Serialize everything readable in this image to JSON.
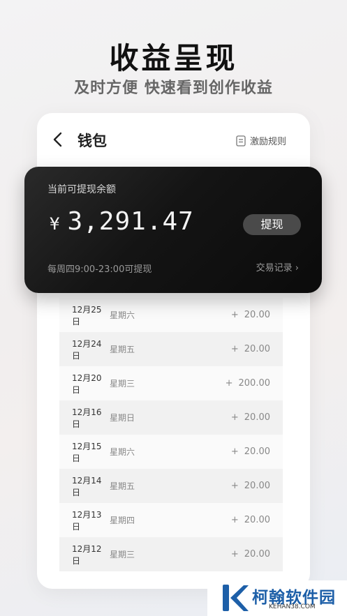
{
  "headline": {
    "title": "收益呈现",
    "subtitle": "及时方便 快速看到创作收益"
  },
  "topbar": {
    "title": "钱包",
    "rules_label": "激励规则"
  },
  "card": {
    "balance_label": "当前可提现余额",
    "currency": "¥",
    "balance": "3,291.47",
    "withdraw_label": "提现",
    "hours": "每周四9:00-23:00可提现",
    "records_label": "交易记录 ›"
  },
  "transactions": [
    {
      "date": "12月25日",
      "weekday": "星期六",
      "sign": "+",
      "amount": "20.00"
    },
    {
      "date": "12月24日",
      "weekday": "星期五",
      "sign": "+",
      "amount": "20.00"
    },
    {
      "date": "12月20日",
      "weekday": "星期三",
      "sign": "+",
      "amount": "200.00"
    },
    {
      "date": "12月16日",
      "weekday": "星期日",
      "sign": "+",
      "amount": "20.00"
    },
    {
      "date": "12月15日",
      "weekday": "星期六",
      "sign": "+",
      "amount": "20.00"
    },
    {
      "date": "12月14日",
      "weekday": "星期五",
      "sign": "+",
      "amount": "20.00"
    },
    {
      "date": "12月13日",
      "weekday": "星期四",
      "sign": "+",
      "amount": "20.00"
    },
    {
      "date": "12月12日",
      "weekday": "星期三",
      "sign": "+",
      "amount": "20.00"
    }
  ],
  "watermark": {
    "name": "柯翰软件园",
    "url": "KEHAN38.COM",
    "brand_color": "#1d5fa8"
  },
  "colors": {
    "card_bg": "#141414",
    "accent_text": "#111111"
  }
}
